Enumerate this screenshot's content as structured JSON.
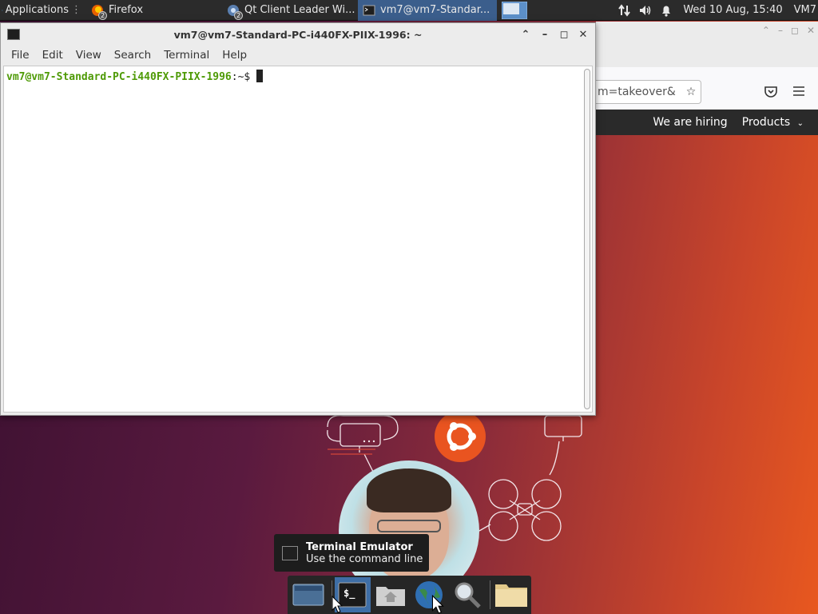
{
  "top_panel": {
    "apps_label": "Applications",
    "tasks": [
      {
        "label": "Firefox",
        "badge": "2"
      },
      {
        "label": "Qt Client Leader Wi...",
        "badge": "2"
      },
      {
        "label": "vm7@vm7-Standar...",
        "badge": ""
      }
    ],
    "clock": "Wed 10 Aug, 15:40",
    "host": "VM7"
  },
  "firefox": {
    "url_fragment": "m=takeover&",
    "nav_items": [
      "We are hiring",
      "Products"
    ]
  },
  "terminal": {
    "title": "vm7@vm7-Standard-PC-i440FX-PIIX-1996: ~",
    "menu": [
      "File",
      "Edit",
      "View",
      "Search",
      "Terminal",
      "Help"
    ],
    "prompt_user": "vm7@vm7-Standard-PC-i440FX-PIIX-1996",
    "prompt_suffix": ":~$"
  },
  "tooltip": {
    "title": "Terminal Emulator",
    "subtitle": "Use the command line"
  },
  "dock": {
    "items": [
      "show-desktop",
      "terminal",
      "home-folder",
      "web-browser",
      "search",
      "file-manager"
    ]
  },
  "colors": {
    "panel_bg": "#2b2b2b",
    "active_task": "#3b5e8c",
    "prompt_green": "#4e9a06",
    "ubuntu_orange": "#e95420"
  }
}
